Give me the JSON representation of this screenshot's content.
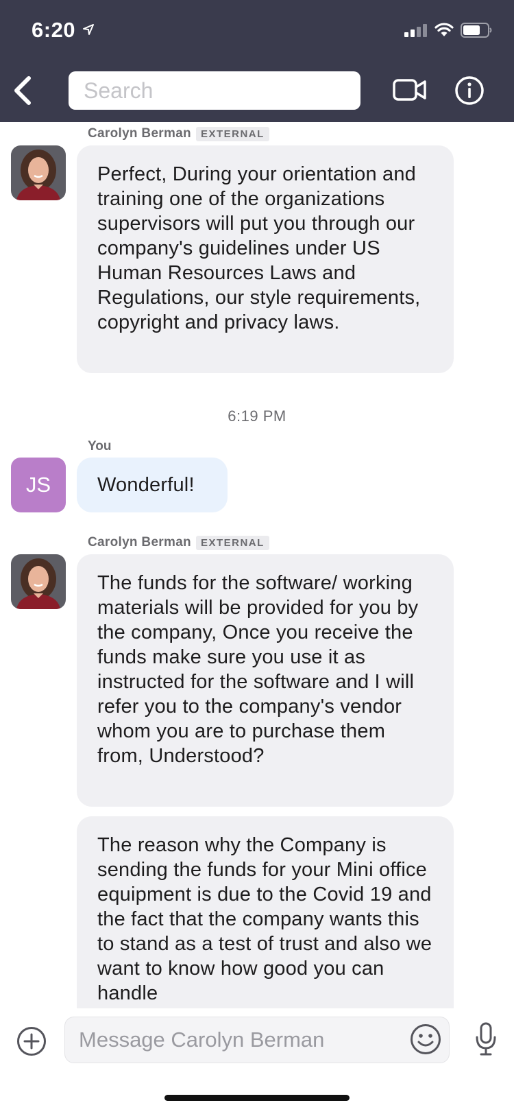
{
  "status_bar": {
    "time": "6:20"
  },
  "header": {
    "search_placeholder": "Search"
  },
  "messages": [
    {
      "sender": "Carolyn Berman",
      "badge": "EXTERNAL",
      "text": "Perfect, During your orientation and training one of the organizations supervisors will put you through our company's guidelines under US Human Resources Laws and Regulations, our style requirements, copyright and privacy laws."
    },
    {
      "timestamp": "6:19 PM",
      "sender": "You",
      "avatar_initials": "JS",
      "text": "Wonderful!"
    },
    {
      "sender": "Carolyn Berman",
      "badge": "EXTERNAL",
      "text": "The funds for the software/ working materials will be provided for you by the company, Once you receive the funds make sure you use it as instructed for the software and I will refer you to the company's vendor whom you are to purchase them from, Understood?"
    },
    {
      "text": "The reason why the Company is sending the funds for your Mini office equipment is due to the Covid 19 and the fact that the company wants this to stand as a test of trust and also we want to know how good you can handle"
    }
  ],
  "compose": {
    "placeholder": "Message Carolyn Berman"
  },
  "colors": {
    "header_bg": "#3a3b4d",
    "avatar_js": "#b97ec9",
    "bubble_other": "#f0f0f3",
    "bubble_mine": "#e9f2fd"
  }
}
